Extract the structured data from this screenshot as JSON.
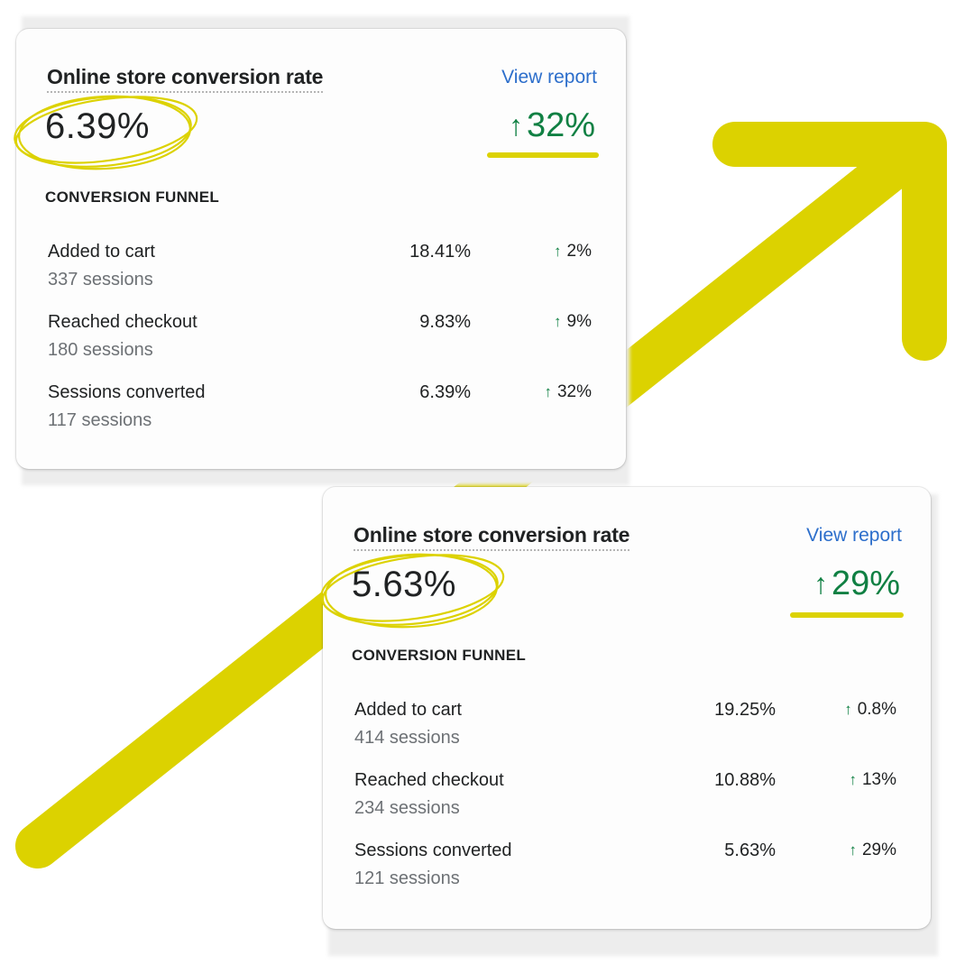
{
  "colors": {
    "highlight": "#dcd200",
    "positive": "#108043",
    "link": "#2c6ecb"
  },
  "cards": [
    {
      "title": "Online store conversion rate",
      "view_report": "View report",
      "value": "6.39%",
      "delta_icon": "arrow-up-icon",
      "delta": "32%",
      "section": "CONVERSION FUNNEL",
      "rows": [
        {
          "label": "Added to cart",
          "sessions": "337 sessions",
          "pct": "18.41%",
          "delta": "2%"
        },
        {
          "label": "Reached checkout",
          "sessions": "180 sessions",
          "pct": "9.83%",
          "delta": "9%"
        },
        {
          "label": "Sessions converted",
          "sessions": "117 sessions",
          "pct": "6.39%",
          "delta": "32%"
        }
      ]
    },
    {
      "title": "Online store conversion rate",
      "view_report": "View report",
      "value": "5.63%",
      "delta_icon": "arrow-up-icon",
      "delta": "29%",
      "section": "CONVERSION FUNNEL",
      "rows": [
        {
          "label": "Added to cart",
          "sessions": "414 sessions",
          "pct": "19.25%",
          "delta": "0.8%"
        },
        {
          "label": "Reached checkout",
          "sessions": "234 sessions",
          "pct": "10.88%",
          "delta": "13%"
        },
        {
          "label": "Sessions converted",
          "sessions": "121 sessions",
          "pct": "5.63%",
          "delta": "29%"
        }
      ]
    }
  ]
}
